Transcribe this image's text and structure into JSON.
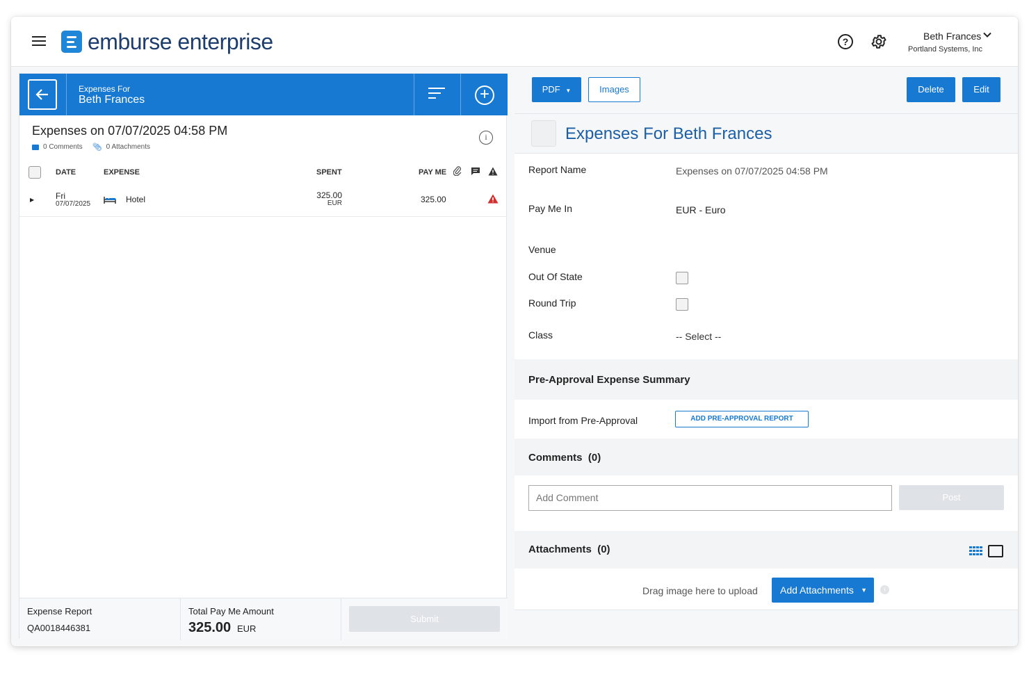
{
  "app": {
    "logo_text": "emburse enterprise",
    "user_name": "Beth Frances",
    "user_company": "Portland Systems, Inc"
  },
  "left": {
    "header_sub": "Expenses For",
    "header_title": "Beth Frances",
    "report_title": "Expenses on 07/07/2025 04:58 PM",
    "comments_count": "0 Comments",
    "attachments_count": "0 Attachments",
    "columns": {
      "date": "DATE",
      "expense": "EXPENSE",
      "spent": "SPENT",
      "pay_me": "PAY ME"
    },
    "rows": [
      {
        "day": "Fri",
        "date": "07/07/2025",
        "expense": "Hotel",
        "spent": "325.00",
        "currency": "EUR",
        "pay_me": "325.00"
      }
    ],
    "footer": {
      "report_label": "Expense Report",
      "report_id": "QA0018446381",
      "total_label": "Total Pay Me Amount",
      "total_value": "325.00",
      "total_currency": "EUR",
      "submit_label": "Submit"
    }
  },
  "right": {
    "toolbar": {
      "pdf_label": "PDF",
      "images_label": "Images",
      "delete_label": "Delete",
      "edit_label": "Edit"
    },
    "title": "Expenses For Beth Frances",
    "fields": {
      "report_name_label": "Report Name",
      "report_name_value": "Expenses on 07/07/2025 04:58 PM",
      "pay_me_in_label": "Pay Me In",
      "pay_me_in_value": "EUR - Euro",
      "venue_label": "Venue",
      "out_of_state_label": "Out Of State",
      "round_trip_label": "Round Trip",
      "class_label": "Class",
      "class_value": "-- Select --"
    },
    "pre_approval": {
      "title": "Pre-Approval Expense Summary",
      "import_label": "Import from Pre-Approval",
      "add_button": "ADD PRE-APPROVAL REPORT"
    },
    "comments": {
      "title": "Comments",
      "count": "(0)",
      "placeholder": "Add Comment",
      "post_label": "Post"
    },
    "attachments": {
      "title": "Attachments",
      "count": "(0)",
      "drag_text": "Drag image here to upload",
      "add_button": "Add Attachments"
    }
  },
  "colors": {
    "primary": "#1779d2",
    "title_blue": "#1a5fa8",
    "warning": "#d32f2f",
    "disabled": "#dfe2e6"
  }
}
